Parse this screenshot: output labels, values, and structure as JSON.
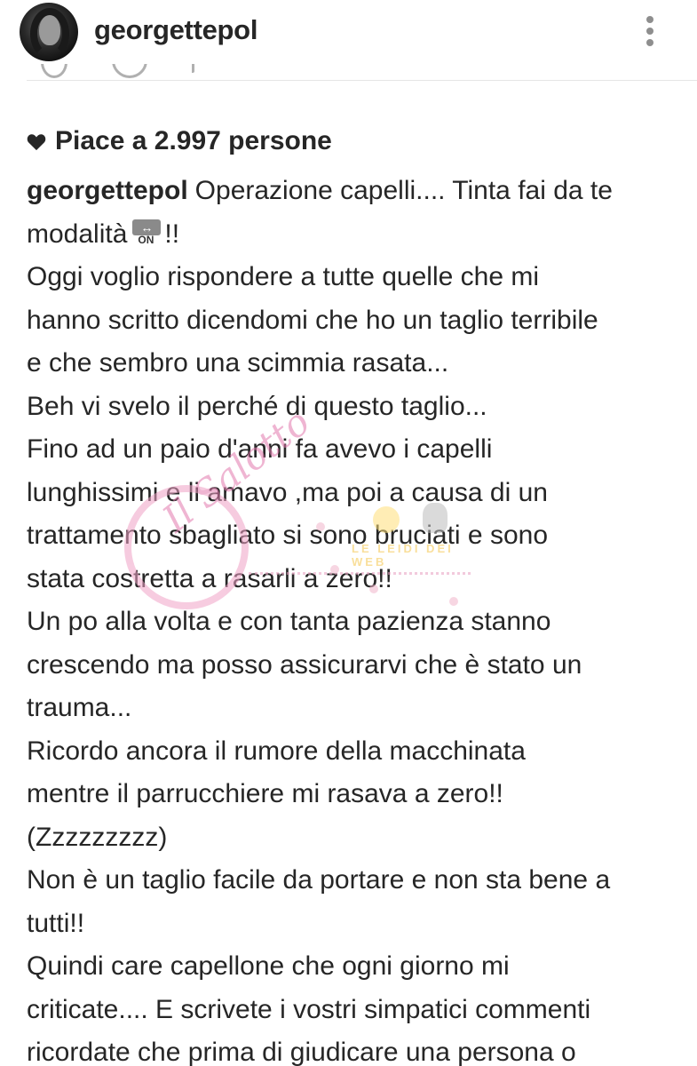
{
  "post": {
    "username": "georgettepol",
    "more_icon": "three-dots-vertical-icon",
    "likes_icon": "heart-icon",
    "likes_text": "Piace a 2.997 persone"
  },
  "caption": {
    "author": "georgettepol",
    "first_line": "Operazione capelli.... Tinta fai da te",
    "second_line_before": "modalità",
    "emoji": {
      "name": "on-arrow-emoji",
      "arrows": "↔",
      "label": "ON"
    },
    "second_line_after": "!!",
    "lines": [
      "Oggi voglio rispondere a tutte quelle che mi",
      "hanno scritto dicendomi che ho un taglio terribile",
      "e che sembro una scimmia rasata...",
      "Beh vi svelo il perché di questo taglio...",
      "Fino ad un paio d'anni fa avevo i capelli",
      "lunghissimi e li amavo ,ma poi a causa di un",
      "trattamento sbagliato si sono bruciati e sono",
      "stata costretta a rasarli a zero!!",
      "Un po alla volta e con tanta pazienza stanno",
      "crescendo ma posso assicurarvi che è stato un",
      "trauma...",
      "Ricordo ancora il rumore della macchinata",
      "mentre il parrucchiere mi rasava a zero!!",
      "(Zzzzzzzzz)",
      "Non è un taglio facile da portare e non sta bene a",
      "tutti!!",
      "Quindi care capellone che ogni giorno mi",
      "criticate.... E scrivete i vostri simpatici commenti",
      "ricordate che prima di giudicare una persona o"
    ]
  },
  "watermark": {
    "script_text": "Il Salotto",
    "sub_text": "LE LEIDI DEI WEB"
  },
  "colors": {
    "text": "#262626",
    "icon_gray": "#8e8e8e",
    "watermark_pink": "#e27aae",
    "watermark_yellow": "#f5c64a"
  }
}
